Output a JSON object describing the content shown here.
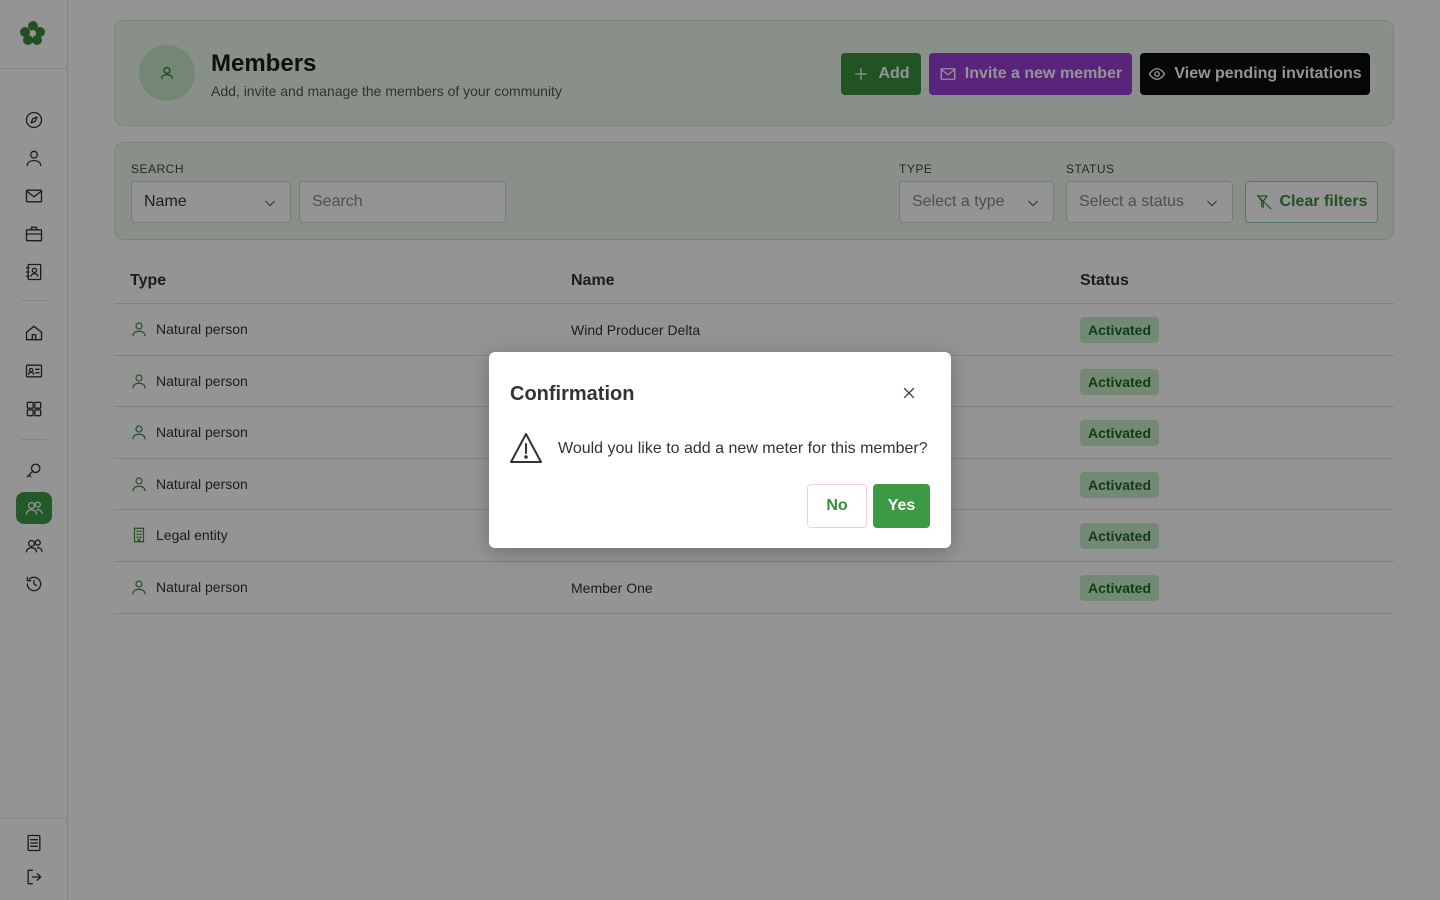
{
  "header": {
    "title": "Members",
    "subtitle": "Add, invite and manage the members of your community",
    "add_label": "Add",
    "invite_label": "Invite a new member",
    "pending_label": "View pending invitations"
  },
  "filters": {
    "search_label": "SEARCH",
    "search_field_value": "Name",
    "search_placeholder": "Search",
    "type_label": "TYPE",
    "type_placeholder": "Select a type",
    "status_label": "STATUS",
    "status_placeholder": "Select a status",
    "clear_label": "Clear filters"
  },
  "table": {
    "columns": [
      "Type",
      "Name",
      "Status"
    ],
    "rows": [
      {
        "type": "Natural person",
        "type_icon": "person-icon",
        "name": "Wind Producer Delta",
        "status": "Activated"
      },
      {
        "type": "Natural person",
        "type_icon": "person-icon",
        "name": "",
        "status": "Activated"
      },
      {
        "type": "Natural person",
        "type_icon": "person-icon",
        "name": "",
        "status": "Activated"
      },
      {
        "type": "Natural person",
        "type_icon": "person-icon",
        "name": "",
        "status": "Activated"
      },
      {
        "type": "Legal entity",
        "type_icon": "building-icon",
        "name": "",
        "status": "Activated"
      },
      {
        "type": "Natural person",
        "type_icon": "person-icon",
        "name": "Member One",
        "status": "Activated"
      }
    ]
  },
  "modal": {
    "title": "Confirmation",
    "message": "Would you like to add a new meter for this member?",
    "no_label": "No",
    "yes_label": "Yes"
  },
  "colors": {
    "accent_green": "#3b9a43",
    "invite_purple": "#9a3fd4",
    "badge_bg": "#c9ecc9",
    "badge_text": "#1d6a25"
  }
}
